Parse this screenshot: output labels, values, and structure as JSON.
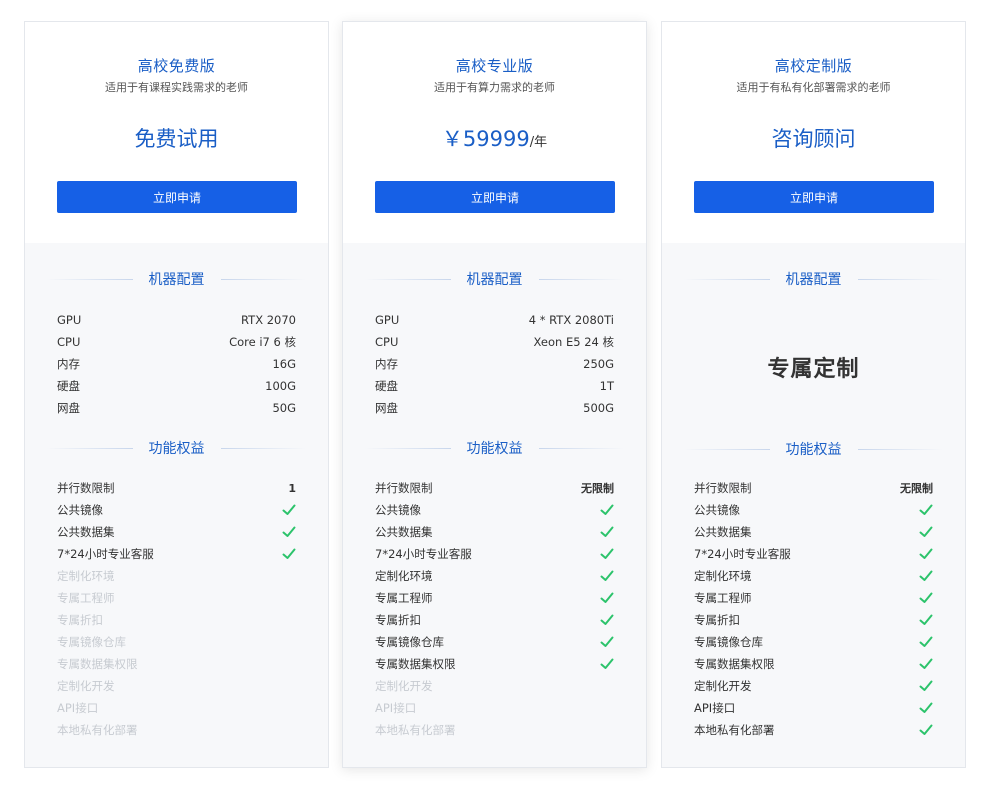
{
  "plans": [
    {
      "title": "高校免费版",
      "subtitle": "适用于有课程实践需求的老师",
      "price": "免费试用",
      "price_unit": "",
      "button": "立即申请",
      "config_heading": "机器配置",
      "config": [
        {
          "label": "GPU",
          "value": "RTX 2070"
        },
        {
          "label": "CPU",
          "value": "Core i7 6 核"
        },
        {
          "label": "内存",
          "value": "16G"
        },
        {
          "label": "硬盘",
          "value": "100G"
        },
        {
          "label": "网盘",
          "value": "50G"
        }
      ],
      "features_heading": "功能权益",
      "features": [
        {
          "label": "并行数限制",
          "value": "1",
          "enabled": true
        },
        {
          "label": "公共镜像",
          "check": true,
          "enabled": true
        },
        {
          "label": "公共数据集",
          "check": true,
          "enabled": true
        },
        {
          "label": "7*24小时专业客服",
          "check": true,
          "enabled": true
        },
        {
          "label": "定制化环境",
          "check": false,
          "enabled": false
        },
        {
          "label": "专属工程师",
          "check": false,
          "enabled": false
        },
        {
          "label": "专属折扣",
          "check": false,
          "enabled": false
        },
        {
          "label": "专属镜像仓库",
          "check": false,
          "enabled": false
        },
        {
          "label": "专属数据集权限",
          "check": false,
          "enabled": false
        },
        {
          "label": "定制化开发",
          "check": false,
          "enabled": false
        },
        {
          "label": "API接口",
          "check": false,
          "enabled": false
        },
        {
          "label": "本地私有化部署",
          "check": false,
          "enabled": false
        }
      ]
    },
    {
      "title": "高校专业版",
      "subtitle": "适用于有算力需求的老师",
      "price": "￥59999",
      "price_unit": "/年",
      "button": "立即申请",
      "config_heading": "机器配置",
      "config": [
        {
          "label": "GPU",
          "value": "4 * RTX 2080Ti"
        },
        {
          "label": "CPU",
          "value": "Xeon E5 24 核"
        },
        {
          "label": "内存",
          "value": "250G"
        },
        {
          "label": "硬盘",
          "value": "1T"
        },
        {
          "label": "网盘",
          "value": "500G"
        }
      ],
      "features_heading": "功能权益",
      "features": [
        {
          "label": "并行数限制",
          "value": "无限制",
          "enabled": true
        },
        {
          "label": "公共镜像",
          "check": true,
          "enabled": true
        },
        {
          "label": "公共数据集",
          "check": true,
          "enabled": true
        },
        {
          "label": "7*24小时专业客服",
          "check": true,
          "enabled": true
        },
        {
          "label": "定制化环境",
          "check": true,
          "enabled": true
        },
        {
          "label": "专属工程师",
          "check": true,
          "enabled": true
        },
        {
          "label": "专属折扣",
          "check": true,
          "enabled": true
        },
        {
          "label": "专属镜像仓库",
          "check": true,
          "enabled": true
        },
        {
          "label": "专属数据集权限",
          "check": true,
          "enabled": true
        },
        {
          "label": "定制化开发",
          "check": false,
          "enabled": false
        },
        {
          "label": "API接口",
          "check": false,
          "enabled": false
        },
        {
          "label": "本地私有化部署",
          "check": false,
          "enabled": false
        }
      ]
    },
    {
      "title": "高校定制版",
      "subtitle": "适用于有私有化部署需求的老师",
      "price": "咨询顾问",
      "price_unit": "",
      "button": "立即申请",
      "config_heading": "机器配置",
      "custom_config": "专属定制",
      "features_heading": "功能权益",
      "features": [
        {
          "label": "并行数限制",
          "value": "无限制",
          "enabled": true
        },
        {
          "label": "公共镜像",
          "check": true,
          "enabled": true
        },
        {
          "label": "公共数据集",
          "check": true,
          "enabled": true
        },
        {
          "label": "7*24小时专业客服",
          "check": true,
          "enabled": true
        },
        {
          "label": "定制化环境",
          "check": true,
          "enabled": true
        },
        {
          "label": "专属工程师",
          "check": true,
          "enabled": true
        },
        {
          "label": "专属折扣",
          "check": true,
          "enabled": true
        },
        {
          "label": "专属镜像仓库",
          "check": true,
          "enabled": true
        },
        {
          "label": "专属数据集权限",
          "check": true,
          "enabled": true
        },
        {
          "label": "定制化开发",
          "check": true,
          "enabled": true
        },
        {
          "label": "API接口",
          "check": true,
          "enabled": true
        },
        {
          "label": "本地私有化部署",
          "check": true,
          "enabled": true
        }
      ]
    }
  ],
  "colors": {
    "accent": "#1a5ec6",
    "button": "#1660e6",
    "check": "#2cc36b",
    "disabled": "#c7cbd1"
  }
}
